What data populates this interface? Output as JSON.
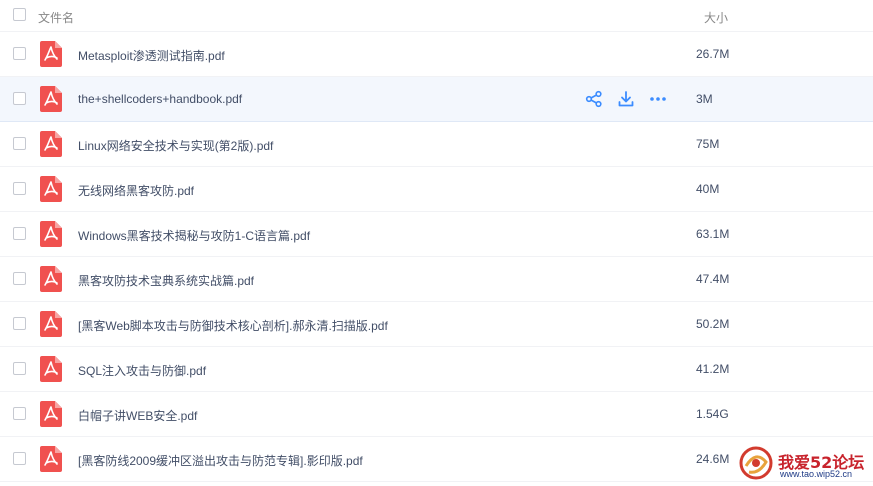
{
  "header": {
    "name_label": "文件名",
    "size_label": "大小"
  },
  "files": [
    {
      "name": "Metasploit渗透测试指南.pdf",
      "size": "26.7M"
    },
    {
      "name": "the+shellcoders+handbook.pdf",
      "size": "3M"
    },
    {
      "name": "Linux网络安全技术与实现(第2版).pdf",
      "size": "75M"
    },
    {
      "name": "无线网络黑客攻防.pdf",
      "size": "40M"
    },
    {
      "name": "Windows黑客技术揭秘与攻防1-C语言篇.pdf",
      "size": "63.1M"
    },
    {
      "name": "黑客攻防技术宝典系统实战篇.pdf",
      "size": "47.4M"
    },
    {
      "name": "[黑客Web脚本攻击与防御技术核心剖析].郝永清.扫描版.pdf",
      "size": "50.2M"
    },
    {
      "name": "SQL注入攻击与防御.pdf",
      "size": "41.2M"
    },
    {
      "name": "白帽子讲WEB安全.pdf",
      "size": "1.54G"
    },
    {
      "name": "[黑客防线2009缓冲区溢出攻击与防范专辑].影印版.pdf",
      "size": "24.6M"
    }
  ],
  "hover_row_index": 1,
  "watermark": {
    "text": "我爱52论坛",
    "url": "www.tao.wip52.cn"
  },
  "colors": {
    "pdf_red": "#f0514f",
    "action_blue": "#3b8cff",
    "hover_bg": "#f3f7fd"
  },
  "icons": {
    "file": "pdf-icon",
    "share": "share-icon",
    "download": "download-icon",
    "more": "more-icon"
  }
}
